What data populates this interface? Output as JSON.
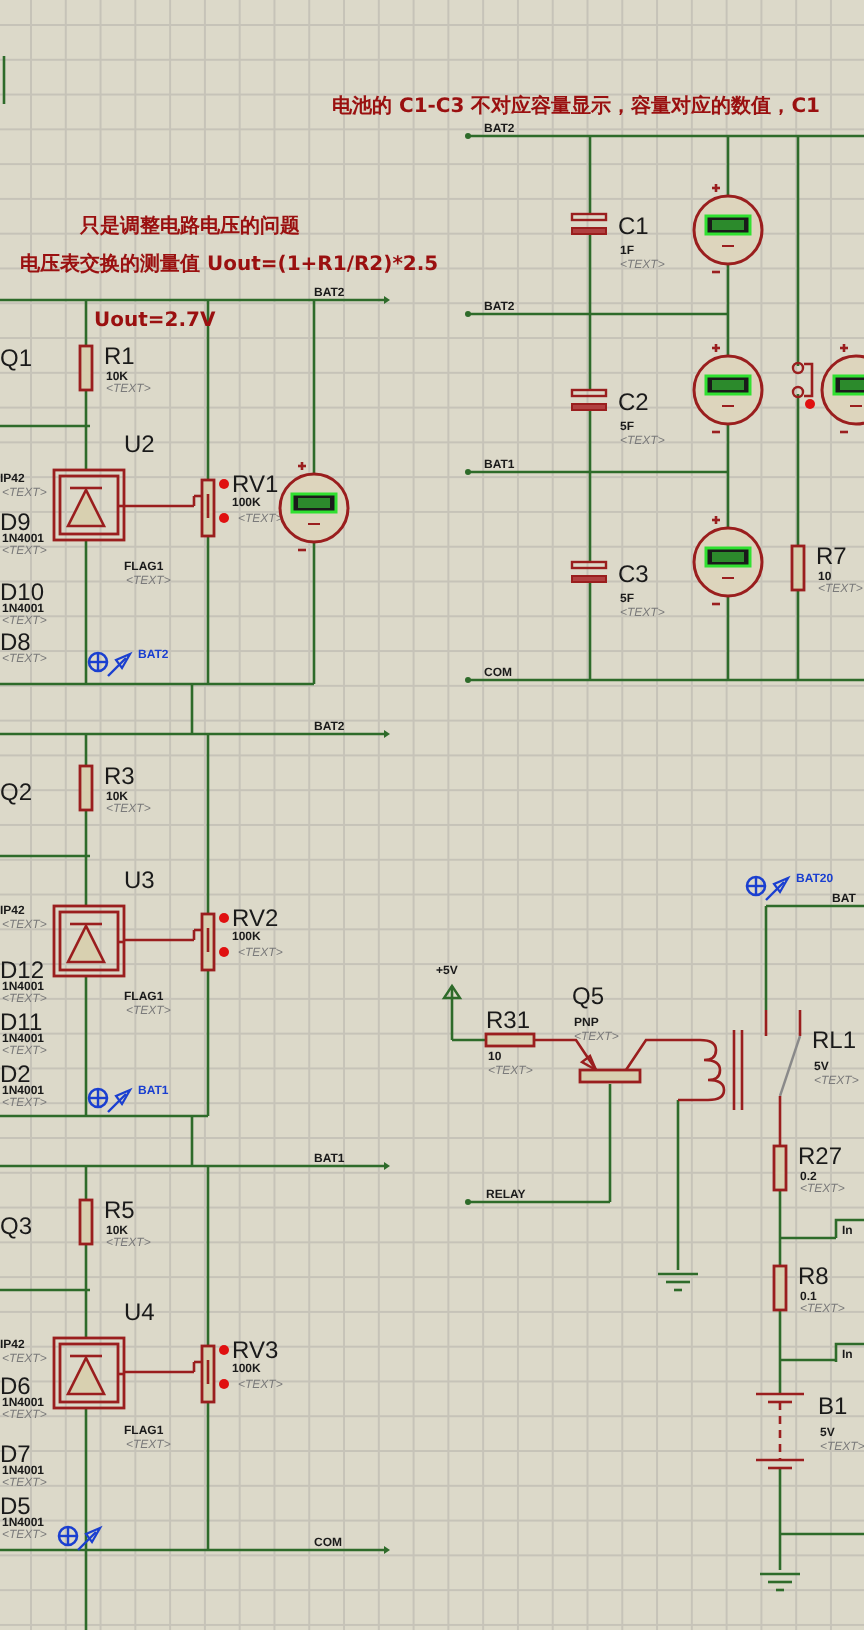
{
  "notes": [
    {
      "text": "电池的 C1-C3 不对应容量显示，容量对应的数值，C1"
    },
    {
      "text": "只是调整电路电压的问题"
    },
    {
      "text": "电压表交换的测量值 Uout=(1+R1/R2)*2.5"
    },
    {
      "text": "Uout=2.7V"
    }
  ],
  "parts": [
    {
      "kind": "tag",
      "ref": "Q1"
    },
    {
      "kind": "resistor",
      "ref": "R1",
      "value": "10K",
      "placeholder": "<TEXT>"
    },
    {
      "kind": "flag",
      "ref": "IP42",
      "placeholder": "<TEXT>"
    },
    {
      "kind": "regulator",
      "ref": "U2"
    },
    {
      "kind": "pot",
      "ref": "RV1",
      "value": "100K",
      "placeholder": "<TEXT>"
    },
    {
      "kind": "tag",
      "ref": "D9",
      "value": "1N4001",
      "placeholder": "<TEXT>"
    },
    {
      "kind": "tag",
      "ref": "D10",
      "value": "1N4001",
      "placeholder": "<TEXT>"
    },
    {
      "kind": "tag",
      "ref": "D8",
      "placeholder": "<TEXT>"
    },
    {
      "kind": "flag",
      "ref": "FLAG1",
      "placeholder": "<TEXT>"
    },
    {
      "kind": "meter"
    },
    {
      "kind": "capacitor",
      "ref": "C1",
      "value": "1F",
      "placeholder": "<TEXT>"
    },
    {
      "kind": "meter"
    },
    {
      "kind": "capacitor",
      "ref": "C2",
      "value": "5F",
      "placeholder": "<TEXT>"
    },
    {
      "kind": "meter"
    },
    {
      "kind": "switch"
    },
    {
      "kind": "meter"
    },
    {
      "kind": "capacitor",
      "ref": "C3",
      "value": "5F",
      "placeholder": "<TEXT>"
    },
    {
      "kind": "meter"
    },
    {
      "kind": "resistor",
      "ref": "R7",
      "value": "10",
      "placeholder": "<TEXT>"
    },
    {
      "kind": "tag",
      "ref": "Q2"
    },
    {
      "kind": "resistor",
      "ref": "R3",
      "value": "10K",
      "placeholder": "<TEXT>"
    },
    {
      "kind": "flag",
      "ref": "IP42",
      "placeholder": "<TEXT>"
    },
    {
      "kind": "regulator",
      "ref": "U3"
    },
    {
      "kind": "pot",
      "ref": "RV2",
      "value": "100K",
      "placeholder": "<TEXT>"
    },
    {
      "kind": "tag",
      "ref": "D12",
      "value": "1N4001",
      "placeholder": "<TEXT>"
    },
    {
      "kind": "flag",
      "ref": "FLAG1",
      "placeholder": "<TEXT>"
    },
    {
      "kind": "tag",
      "ref": "D11",
      "value": "1N4001",
      "placeholder": "<TEXT>"
    },
    {
      "kind": "tag",
      "ref": "D2",
      "value": "1N4001",
      "placeholder": "<TEXT>"
    },
    {
      "kind": "tag",
      "ref": "Q3"
    },
    {
      "kind": "resistor",
      "ref": "R5",
      "value": "10K",
      "placeholder": "<TEXT>"
    },
    {
      "kind": "flag",
      "ref": "IP42",
      "placeholder": "<TEXT>"
    },
    {
      "kind": "regulator",
      "ref": "U4"
    },
    {
      "kind": "pot",
      "ref": "RV3",
      "value": "100K",
      "placeholder": "<TEXT>"
    },
    {
      "kind": "tag",
      "ref": "D6",
      "value": "1N4001",
      "placeholder": "<TEXT>"
    },
    {
      "kind": "flag",
      "ref": "FLAG1",
      "placeholder": "<TEXT>"
    },
    {
      "kind": "tag",
      "ref": "D7",
      "value": "1N4001",
      "placeholder": "<TEXT>"
    },
    {
      "kind": "tag",
      "ref": "D5",
      "value": "1N4001",
      "placeholder": "<TEXT>"
    },
    {
      "kind": "power",
      "ref": "+5V"
    },
    {
      "kind": "resistor_h",
      "ref": "R31",
      "value": "10",
      "placeholder": "<TEXT>"
    },
    {
      "kind": "pnp",
      "ref": "Q5",
      "value": "PNP",
      "placeholder": "<TEXT>"
    },
    {
      "kind": "relay",
      "ref": "RL1",
      "value": "5V",
      "placeholder": "<TEXT>"
    },
    {
      "kind": "ground"
    },
    {
      "kind": "resistor",
      "ref": "R27",
      "value": "0.2",
      "placeholder": "<TEXT>"
    },
    {
      "kind": "port",
      "ref": "In"
    },
    {
      "kind": "resistor",
      "ref": "R8",
      "value": "0.1",
      "placeholder": "<TEXT>"
    },
    {
      "kind": "port",
      "ref": "In"
    },
    {
      "kind": "battery",
      "ref": "B1",
      "value": "5V",
      "placeholder": "<TEXT>"
    },
    {
      "kind": "ground"
    }
  ],
  "net_labels": [
    {
      "text": "BAT2"
    },
    {
      "text": "BAT2"
    },
    {
      "text": "BAT2"
    },
    {
      "text": "BAT1"
    },
    {
      "text": "COM"
    },
    {
      "text": "BAT2"
    },
    {
      "text": "BAT1"
    },
    {
      "text": "RELAY"
    },
    {
      "text": "COM"
    },
    {
      "text": "BAT"
    }
  ],
  "probes": [
    {
      "text": "BAT2"
    },
    {
      "text": "BAT1"
    },
    {
      "text": "BAT20"
    }
  ]
}
